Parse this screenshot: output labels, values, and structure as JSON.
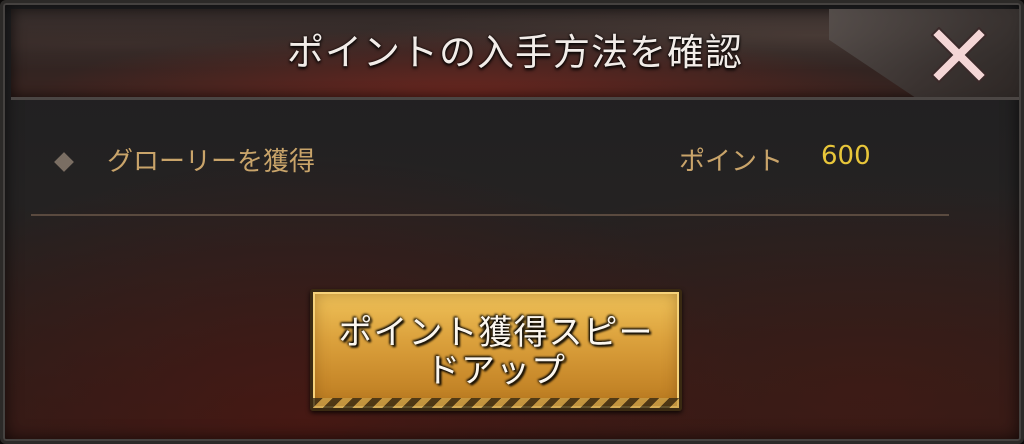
{
  "dialog": {
    "title": "ポイントの入手方法を確認",
    "close_icon": "close-x-icon"
  },
  "items": [
    {
      "bullet_icon": "diamond-bullet-icon",
      "label": "グローリーを獲得",
      "points_label": "ポイント",
      "points_value": "600"
    }
  ],
  "action_button": {
    "label_line1": "ポイント獲得スピー",
    "label_line2": "ドアップ"
  },
  "colors": {
    "title_text": "#f2ece8",
    "label_gold": "#c9a46a",
    "value_yellow": "#e8c63a",
    "button_gold": "#dca23d"
  }
}
